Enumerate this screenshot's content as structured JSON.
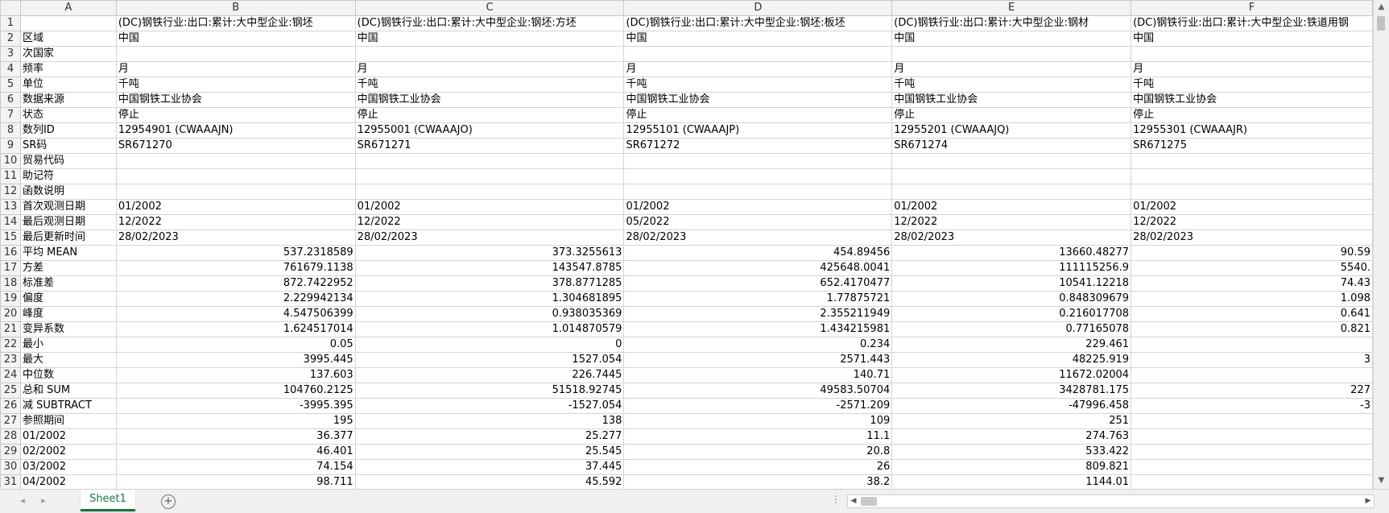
{
  "columns": [
    "A",
    "B",
    "C",
    "D",
    "E",
    "F"
  ],
  "rows": [
    {
      "n": "1",
      "a": "",
      "b": "(DC)钢铁行业:出口:累计:大中型企业:钢坯",
      "c": "(DC)钢铁行业:出口:累计:大中型企业:钢坯:方坯",
      "d": "(DC)钢铁行业:出口:累计:大中型企业:钢坯:板坯",
      "e": "(DC)钢铁行业:出口:累计:大中型企业:钢材",
      "f": "(DC)钢铁行业:出口:累计:大中型企业:铁道用钢"
    },
    {
      "n": "2",
      "a": "区域",
      "b": "中国",
      "c": "中国",
      "d": "中国",
      "e": "中国",
      "f": "中国"
    },
    {
      "n": "3",
      "a": "次国家",
      "b": "",
      "c": "",
      "d": "",
      "e": "",
      "f": ""
    },
    {
      "n": "4",
      "a": "频率",
      "b": "月",
      "c": "月",
      "d": "月",
      "e": "月",
      "f": "月"
    },
    {
      "n": "5",
      "a": "单位",
      "b": "千吨",
      "c": "千吨",
      "d": "千吨",
      "e": "千吨",
      "f": "千吨"
    },
    {
      "n": "6",
      "a": "数据来源",
      "b": "中国钢铁工业协会",
      "c": "中国钢铁工业协会",
      "d": "中国钢铁工业协会",
      "e": "中国钢铁工业协会",
      "f": "中国钢铁工业协会"
    },
    {
      "n": "7",
      "a": "状态",
      "b": "停止",
      "c": "停止",
      "d": "停止",
      "e": "停止",
      "f": "停止"
    },
    {
      "n": "8",
      "a": "数列ID",
      "b": "12954901 (CWAAAJN)",
      "c": "12955001 (CWAAAJO)",
      "d": "12955101 (CWAAAJP)",
      "e": "12955201 (CWAAAJQ)",
      "f": "12955301 (CWAAAJR)"
    },
    {
      "n": "9",
      "a": "SR码",
      "b": "SR671270",
      "c": "SR671271",
      "d": "SR671272",
      "e": "SR671274",
      "f": "SR671275"
    },
    {
      "n": "10",
      "a": "贸易代码",
      "b": "",
      "c": "",
      "d": "",
      "e": "",
      "f": ""
    },
    {
      "n": "11",
      "a": "助记符",
      "b": "",
      "c": "",
      "d": "",
      "e": "",
      "f": ""
    },
    {
      "n": "12",
      "a": "函数说明",
      "b": "",
      "c": "",
      "d": "",
      "e": "",
      "f": ""
    },
    {
      "n": "13",
      "a": "首次观测日期",
      "b": "01/2002",
      "c": "01/2002",
      "d": "01/2002",
      "e": "01/2002",
      "f": "01/2002"
    },
    {
      "n": "14",
      "a": "最后观测日期",
      "b": "12/2022",
      "c": "12/2022",
      "d": "05/2022",
      "e": "12/2022",
      "f": "12/2022"
    },
    {
      "n": "15",
      "a": "最后更新时间",
      "b": "28/02/2023",
      "c": "28/02/2023",
      "d": "28/02/2023",
      "e": "28/02/2023",
      "f": "28/02/2023"
    },
    {
      "n": "16",
      "a": "平均 MEAN",
      "b": "537.2318589",
      "c": "373.3255613",
      "d": "454.89456",
      "e": "13660.48277",
      "f": "90.59"
    },
    {
      "n": "17",
      "a": "方差",
      "b": "761679.1138",
      "c": "143547.8785",
      "d": "425648.0041",
      "e": "111115256.9",
      "f": "5540."
    },
    {
      "n": "18",
      "a": "标准差",
      "b": "872.7422952",
      "c": "378.8771285",
      "d": "652.4170477",
      "e": "10541.12218",
      "f": "74.43"
    },
    {
      "n": "19",
      "a": "偏度",
      "b": "2.229942134",
      "c": "1.304681895",
      "d": "1.77875721",
      "e": "0.848309679",
      "f": "1.098"
    },
    {
      "n": "20",
      "a": "峰度",
      "b": "4.547506399",
      "c": "0.938035369",
      "d": "2.355211949",
      "e": "0.216017708",
      "f": "0.641"
    },
    {
      "n": "21",
      "a": "变异系数",
      "b": "1.624517014",
      "c": "1.014870579",
      "d": "1.434215981",
      "e": "0.77165078",
      "f": "0.821"
    },
    {
      "n": "22",
      "a": "最小",
      "b": "0.05",
      "c": "0",
      "d": "0.234",
      "e": "229.461",
      "f": ""
    },
    {
      "n": "23",
      "a": "最大",
      "b": "3995.445",
      "c": "1527.054",
      "d": "2571.443",
      "e": "48225.919",
      "f": "3"
    },
    {
      "n": "24",
      "a": "中位数",
      "b": "137.603",
      "c": "226.7445",
      "d": "140.71",
      "e": "11672.02004",
      "f": ""
    },
    {
      "n": "25",
      "a": "总和 SUM",
      "b": "104760.2125",
      "c": "51518.92745",
      "d": "49583.50704",
      "e": "3428781.175",
      "f": "227"
    },
    {
      "n": "26",
      "a": "减 SUBTRACT",
      "b": "-3995.395",
      "c": "-1527.054",
      "d": "-2571.209",
      "e": "-47996.458",
      "f": "-3"
    },
    {
      "n": "27",
      "a": "参照期间",
      "b": "195",
      "c": "138",
      "d": "109",
      "e": "251",
      "f": ""
    },
    {
      "n": "28",
      "a": "01/2002",
      "b": "36.377",
      "c": "25.277",
      "d": "11.1",
      "e": "274.763",
      "f": ""
    },
    {
      "n": "29",
      "a": "02/2002",
      "b": "46.401",
      "c": "25.545",
      "d": "20.8",
      "e": "533.422",
      "f": ""
    },
    {
      "n": "30",
      "a": "03/2002",
      "b": "74.154",
      "c": "37.445",
      "d": "26",
      "e": "809.821",
      "f": ""
    },
    {
      "n": "31",
      "a": "04/2002",
      "b": "98.711",
      "c": "45.592",
      "d": "38.2",
      "e": "1144.01",
      "f": ""
    }
  ],
  "numeric_from_row": 16,
  "sheet_tab": "Sheet1",
  "add_sheet_symbol": "+",
  "dots": "⋮",
  "icons": {
    "scroll_up": "▲",
    "scroll_down": "▼",
    "scroll_left": "◀",
    "scroll_right": "▶",
    "nav_prev": "◂",
    "nav_next": "▸"
  },
  "accent_color": "#1e7145"
}
